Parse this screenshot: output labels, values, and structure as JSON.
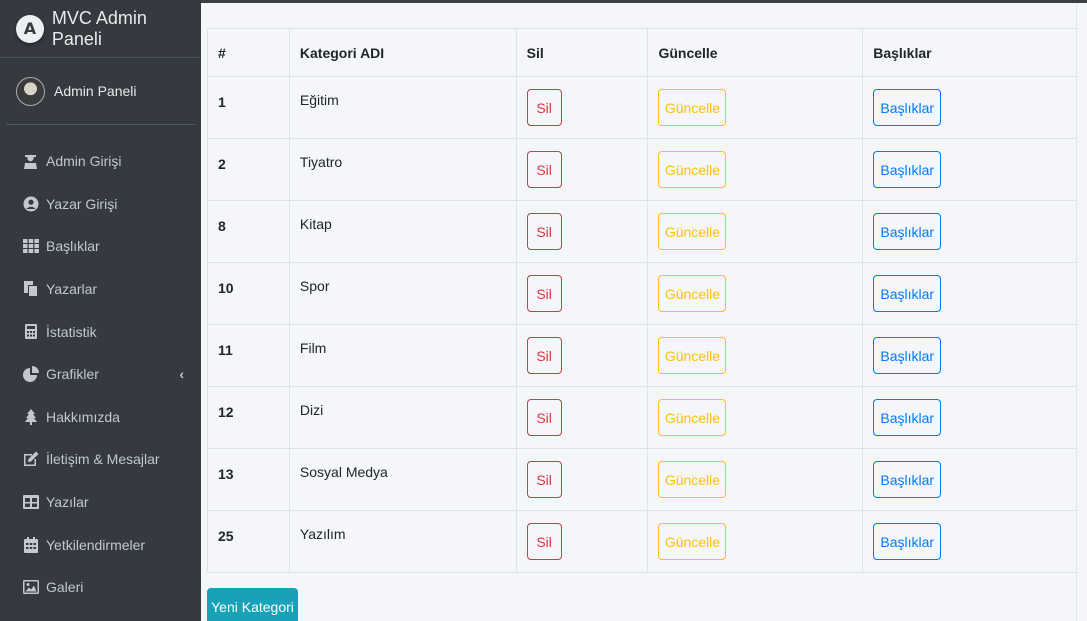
{
  "brand": {
    "title": "MVC Admin Paneli",
    "logo_letter": "A"
  },
  "user": {
    "name": "Admin Paneli"
  },
  "sidebar": {
    "items": [
      {
        "label": "Admin Girişi",
        "icon": "user-secret-icon"
      },
      {
        "label": "Yazar Girişi",
        "icon": "user-circle-icon"
      },
      {
        "label": "Başlıklar",
        "icon": "th-icon"
      },
      {
        "label": "Yazarlar",
        "icon": "copy-icon"
      },
      {
        "label": "İstatistik",
        "icon": "calculator-icon"
      },
      {
        "label": "Grafikler",
        "icon": "chart-pie-icon"
      },
      {
        "label": "Hakkımızda",
        "icon": "tree-icon"
      },
      {
        "label": "İletişim & Mesajlar",
        "icon": "edit-icon"
      },
      {
        "label": "Yazılar",
        "icon": "table-icon"
      },
      {
        "label": "Yetkilendirmeler",
        "icon": "calendar-icon"
      },
      {
        "label": "Galeri",
        "icon": "image-icon"
      }
    ]
  },
  "table": {
    "headers": [
      "#",
      "Kategori ADI",
      "Sil",
      "Güncelle",
      "Başlıklar"
    ],
    "rows": [
      {
        "id": "1",
        "name": "Eğitim"
      },
      {
        "id": "2",
        "name": "Tiyatro"
      },
      {
        "id": "8",
        "name": "Kitap"
      },
      {
        "id": "10",
        "name": "Spor"
      },
      {
        "id": "11",
        "name": "Film"
      },
      {
        "id": "12",
        "name": "Dizi"
      },
      {
        "id": "13",
        "name": "Sosyal Medya"
      },
      {
        "id": "25",
        "name": "Yazılım"
      }
    ],
    "delete_label": "Sil",
    "update_label": "Güncelle",
    "titles_label": "Başlıklar"
  },
  "actions": {
    "new_category_label": "Yeni Kategori"
  },
  "colors": {
    "sidebar": "#343a40",
    "danger": "#dc3545",
    "warning": "#ffc107",
    "primary": "#007bff",
    "info": "#17a2b8"
  }
}
